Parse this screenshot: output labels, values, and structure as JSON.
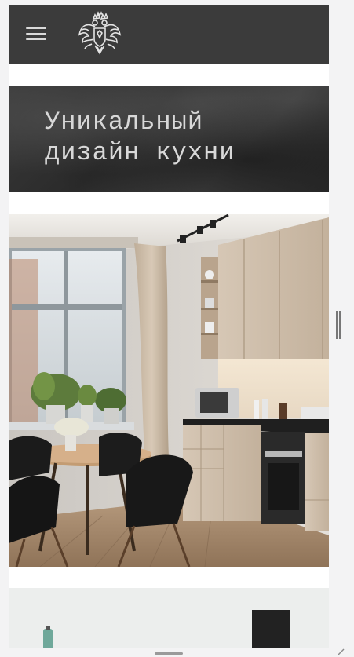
{
  "header": {
    "menu_icon": "hamburger-menu-icon",
    "logo_icon": "double-headed-eagle-crest-icon"
  },
  "banner": {
    "title_line1": "Уникальный",
    "title_line2": "дизайн кухни"
  },
  "colors": {
    "header_bg": "#3b3b3b",
    "banner_text": "#d8d8d8",
    "page_bg": "#f3f3f4"
  }
}
